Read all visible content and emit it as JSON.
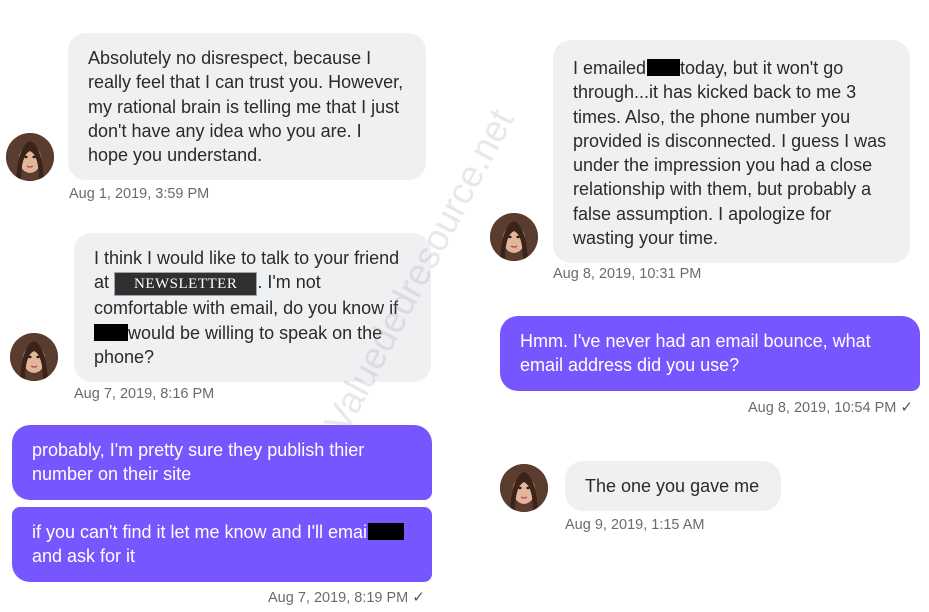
{
  "watermark": "Valuededresource.net",
  "check_glyph": "✓",
  "redacted_tag": "NEWSLETTER",
  "messages": {
    "m1": {
      "text": "Absolutely no disrespect, because I really feel that I can trust you. However, my rational brain is telling me that I just don't have any idea who you are. I hope you understand.",
      "timestamp": "Aug 1, 2019, 3:59 PM"
    },
    "m2": {
      "part1": "I think I would like to talk to your friend at ",
      "part2": ". I'm not comfortable with email, do you know if ",
      "part3": "would be willing to speak on the phone?",
      "timestamp": "Aug 7, 2019, 8:16 PM"
    },
    "m3": {
      "text": "probably, I'm pretty sure they publish thier number on their site"
    },
    "m4": {
      "part1": "if you can't find it let me know and I'll email ",
      "part2": "and ask for it",
      "timestamp": "Aug 7, 2019, 8:19 PM"
    },
    "m5": {
      "part1": "I emailed ",
      "part2": "today, but it won't go through...it has kicked back to me 3 times. Also, the phone number you provided is disconnected. I guess I was under the impression you had a close relationship with them, but probably a false assumption. I apologize for wasting your time.",
      "timestamp": "Aug 8, 2019, 10:31 PM"
    },
    "m6": {
      "text": "Hmm. I've never had an email bounce, what email address did you use?",
      "timestamp": "Aug 8, 2019, 10:54 PM"
    },
    "m7": {
      "text": "The one you gave me",
      "timestamp": "Aug 9, 2019, 1:15 AM"
    }
  },
  "colors": {
    "incoming_bg": "#eef0f2",
    "outgoing_bg": "#7856ff",
    "timestamp": "#6b6b6b"
  }
}
